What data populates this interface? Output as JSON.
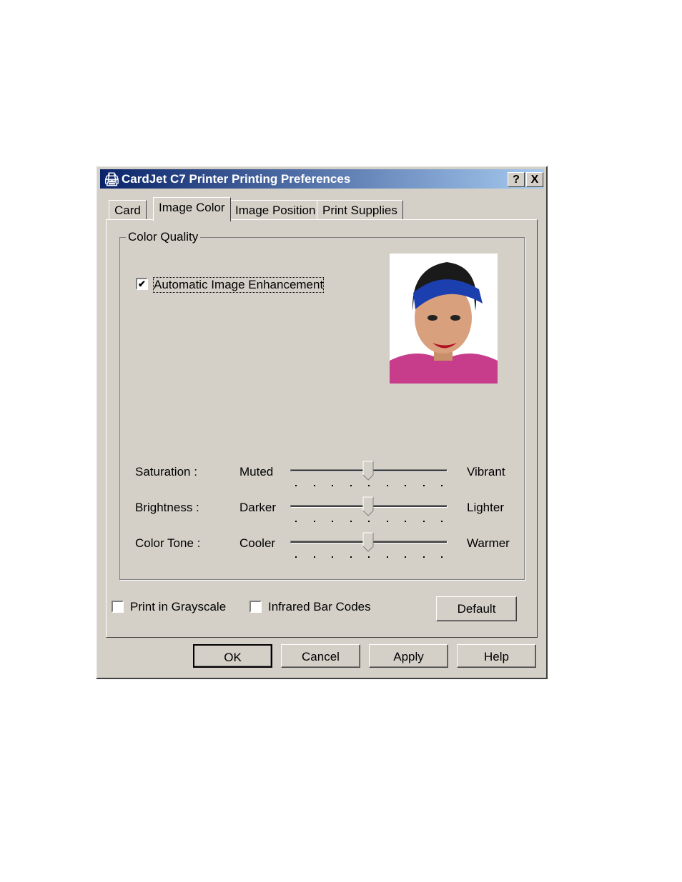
{
  "window": {
    "title": "CardJet C7 Printer Printing Preferences",
    "help_button": "?",
    "close_button": "X"
  },
  "tabs": [
    {
      "label": "Card"
    },
    {
      "label": "Image Color",
      "active": true
    },
    {
      "label": "Image Position"
    },
    {
      "label": "Print Supplies"
    }
  ],
  "group": {
    "label": "Color Quality",
    "auto_enhance": {
      "label": "Automatic Image Enhancement",
      "checked": true
    }
  },
  "sliders": [
    {
      "label": "Saturation :",
      "min_label": "Muted",
      "max_label": "Vibrant",
      "value": 4,
      "min": 0,
      "max": 8
    },
    {
      "label": "Brightness :",
      "min_label": "Darker",
      "max_label": "Lighter",
      "value": 4,
      "min": 0,
      "max": 8
    },
    {
      "label": "Color Tone :",
      "min_label": "Cooler",
      "max_label": "Warmer",
      "value": 4,
      "min": 0,
      "max": 8
    }
  ],
  "options": {
    "grayscale": {
      "label": "Print in Grayscale",
      "checked": false
    },
    "infrared": {
      "label": "Infrared Bar Codes",
      "checked": false
    },
    "default_button": "Default"
  },
  "buttons": {
    "ok": "OK",
    "cancel": "Cancel",
    "apply": "Apply",
    "help": "Help"
  }
}
